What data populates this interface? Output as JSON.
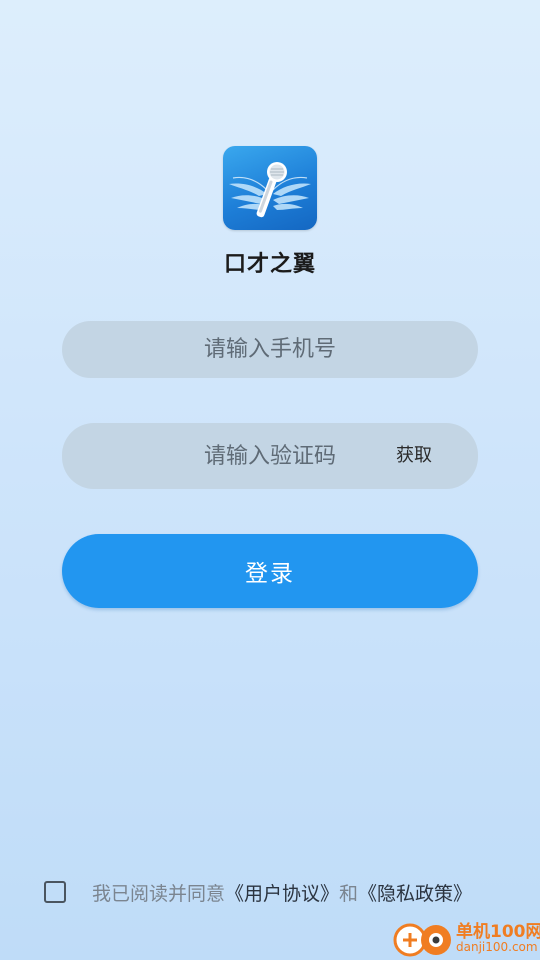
{
  "app": {
    "name": "口才之翼",
    "logo_icon": "winged-microphone-icon",
    "accent_color": "#2296f0"
  },
  "login_form": {
    "phone_placeholder": "请输入手机号",
    "code_placeholder": "请输入验证码",
    "get_code_label": "获取",
    "login_label": "登录"
  },
  "agreement": {
    "checked": false,
    "prefix": "我已阅读并同意",
    "user_agreement_link": "《用户协议》",
    "conjunction": "和",
    "privacy_policy_link": "《隐私政策》"
  },
  "watermark": {
    "title": "单机100网",
    "url": "danji100.com"
  }
}
